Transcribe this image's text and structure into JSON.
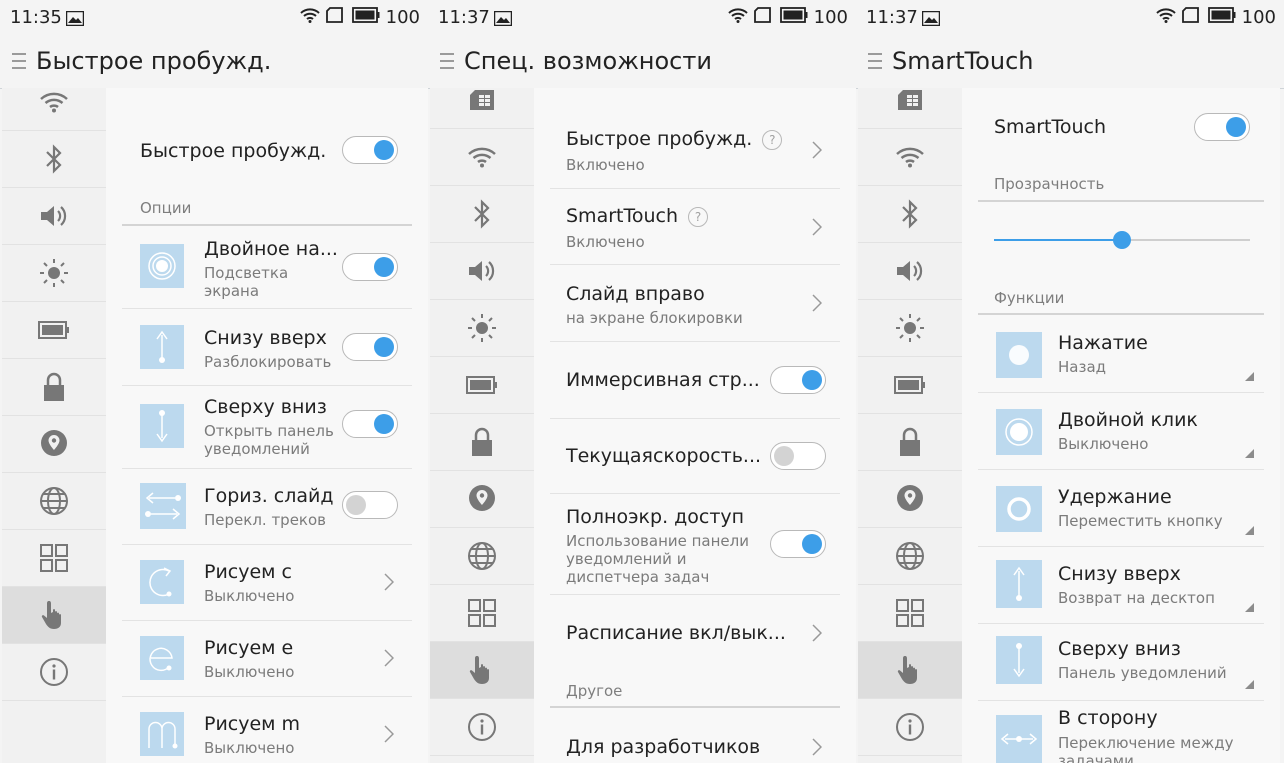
{
  "colors": {
    "accent": "#3d9ee8",
    "tile": "#bcd9ee",
    "toggle_off": "#d3d3d3"
  },
  "status_icons": [
    "image-icon",
    "wifi-icon",
    "sim-icon",
    "battery-icon"
  ],
  "screen1": {
    "status": {
      "time": "11:35",
      "battery": "100"
    },
    "title": "Быстрое пробужд.",
    "rail": [
      "wifi-icon",
      "bluetooth-icon",
      "volume-icon",
      "brightness-icon",
      "battery-icon",
      "lock-icon",
      "location-icon",
      "globe-icon",
      "apps-grid-icon",
      "gesture-hand-icon",
      "info-icon"
    ],
    "main_toggle": {
      "label": "Быстрое пробужд.",
      "on": true
    },
    "section": "Опции",
    "items": [
      {
        "title": "Двойное на...",
        "sub": "Подсветка экрана",
        "control": "toggle",
        "on": true
      },
      {
        "title": "Снизу вверх",
        "sub": "Разблокировать",
        "control": "toggle",
        "on": true
      },
      {
        "title": "Сверху вниз",
        "sub": "Открыть панель уведомлений",
        "control": "toggle",
        "on": true
      },
      {
        "title": "Гориз. слайд",
        "sub": "Перекл. треков",
        "control": "toggle",
        "on": false
      },
      {
        "title": "Рисуем с",
        "sub": "Выключено",
        "control": "chevron"
      },
      {
        "title": "Рисуем е",
        "sub": "Выключено",
        "control": "chevron"
      },
      {
        "title": "Рисуем m",
        "sub": "Выключено",
        "control": "chevron"
      }
    ]
  },
  "screen2": {
    "status": {
      "time": "11:37",
      "battery": "100"
    },
    "title": "Спец. возможности",
    "rail": [
      "sim-card-icon",
      "wifi-icon",
      "bluetooth-icon",
      "volume-icon",
      "brightness-icon",
      "battery-icon",
      "lock-icon",
      "location-icon",
      "globe-icon",
      "apps-grid-icon",
      "gesture-hand-icon",
      "info-icon"
    ],
    "items": [
      {
        "title": "Быстрое пробужд.",
        "sub": "Включено",
        "help": true,
        "control": "chevron"
      },
      {
        "title": "SmartTouch",
        "sub": "Включено",
        "help": true,
        "control": "chevron"
      },
      {
        "title": "Слайд вправо",
        "sub": "на экране блокировки",
        "control": "chevron"
      },
      {
        "title": "Иммерсивная стр...",
        "control": "toggle",
        "on": true
      },
      {
        "title": "Текущаяскорость...",
        "control": "toggle",
        "on": false
      },
      {
        "title": "Полноэкр. доступ",
        "sub": "Использование панели уведомлений и диспетчера задач",
        "control": "toggle",
        "on": true
      },
      {
        "title": "Расписание вкл/вык...",
        "control": "chevron"
      }
    ],
    "section": "Другое",
    "dev_item": "Для разработчиков"
  },
  "screen3": {
    "status": {
      "time": "11:37",
      "battery": "100"
    },
    "title": "SmartTouch",
    "rail": [
      "sim-card-icon",
      "wifi-icon",
      "bluetooth-icon",
      "volume-icon",
      "brightness-icon",
      "battery-icon",
      "lock-icon",
      "location-icon",
      "globe-icon",
      "apps-grid-icon",
      "gesture-hand-icon",
      "info-icon"
    ],
    "main_toggle": {
      "label": "SmartTouch",
      "on": true
    },
    "transparency_label": "Прозрачность",
    "transparency_value": 0.5,
    "section": "Функции",
    "items": [
      {
        "title": "Нажатие",
        "sub": "Назад"
      },
      {
        "title": "Двойной клик",
        "sub": "Выключено"
      },
      {
        "title": "Удержание",
        "sub": "Переместить кнопку"
      },
      {
        "title": "Снизу вверх",
        "sub": "Возврат на десктоп"
      },
      {
        "title": "Сверху вниз",
        "sub": "Панель уведомлений"
      },
      {
        "title": "В сторону",
        "sub": "Переключение между задачами"
      }
    ]
  }
}
